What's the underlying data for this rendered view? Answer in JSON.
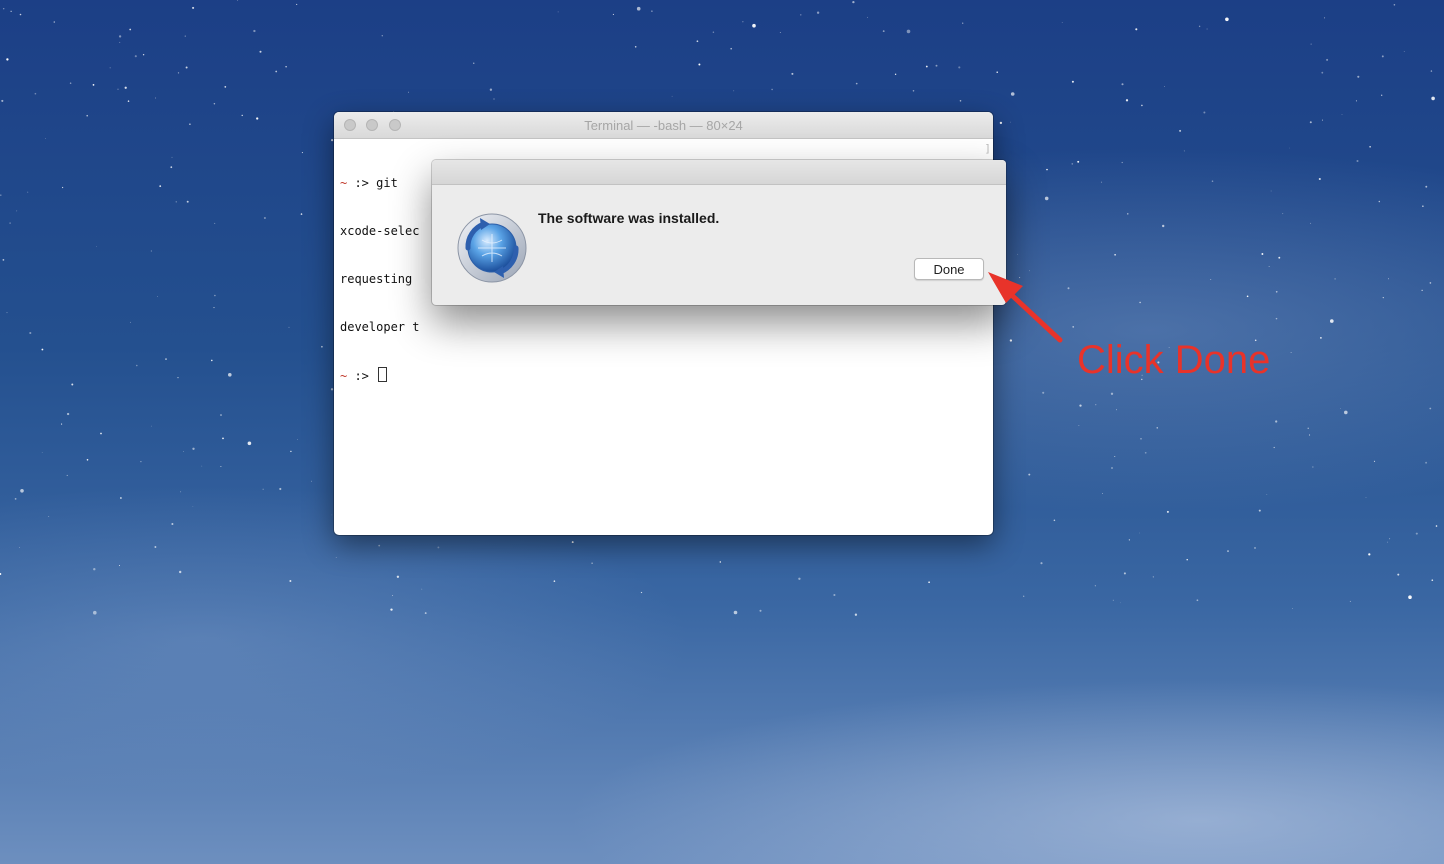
{
  "terminal": {
    "title": "Terminal — -bash — 80×24",
    "lines": [
      {
        "prompt": "~",
        "text": " :> git"
      },
      {
        "prompt": "",
        "text": "xcode-selec"
      },
      {
        "prompt": "",
        "text": "requesting"
      },
      {
        "prompt": "",
        "text": "developer t"
      },
      {
        "prompt": "~",
        "text": " :> "
      }
    ],
    "scroll_hint": "]"
  },
  "dialog": {
    "message": "The software was installed.",
    "done_label": "Done",
    "icon": "software-update-icon"
  },
  "annotation": {
    "text": "Click Done",
    "color": "#e8332a"
  },
  "colors": {
    "prompt_tilde": "#c0392b",
    "desktop_top": "#1c3f86",
    "desktop_bottom": "#6d8fbf"
  }
}
